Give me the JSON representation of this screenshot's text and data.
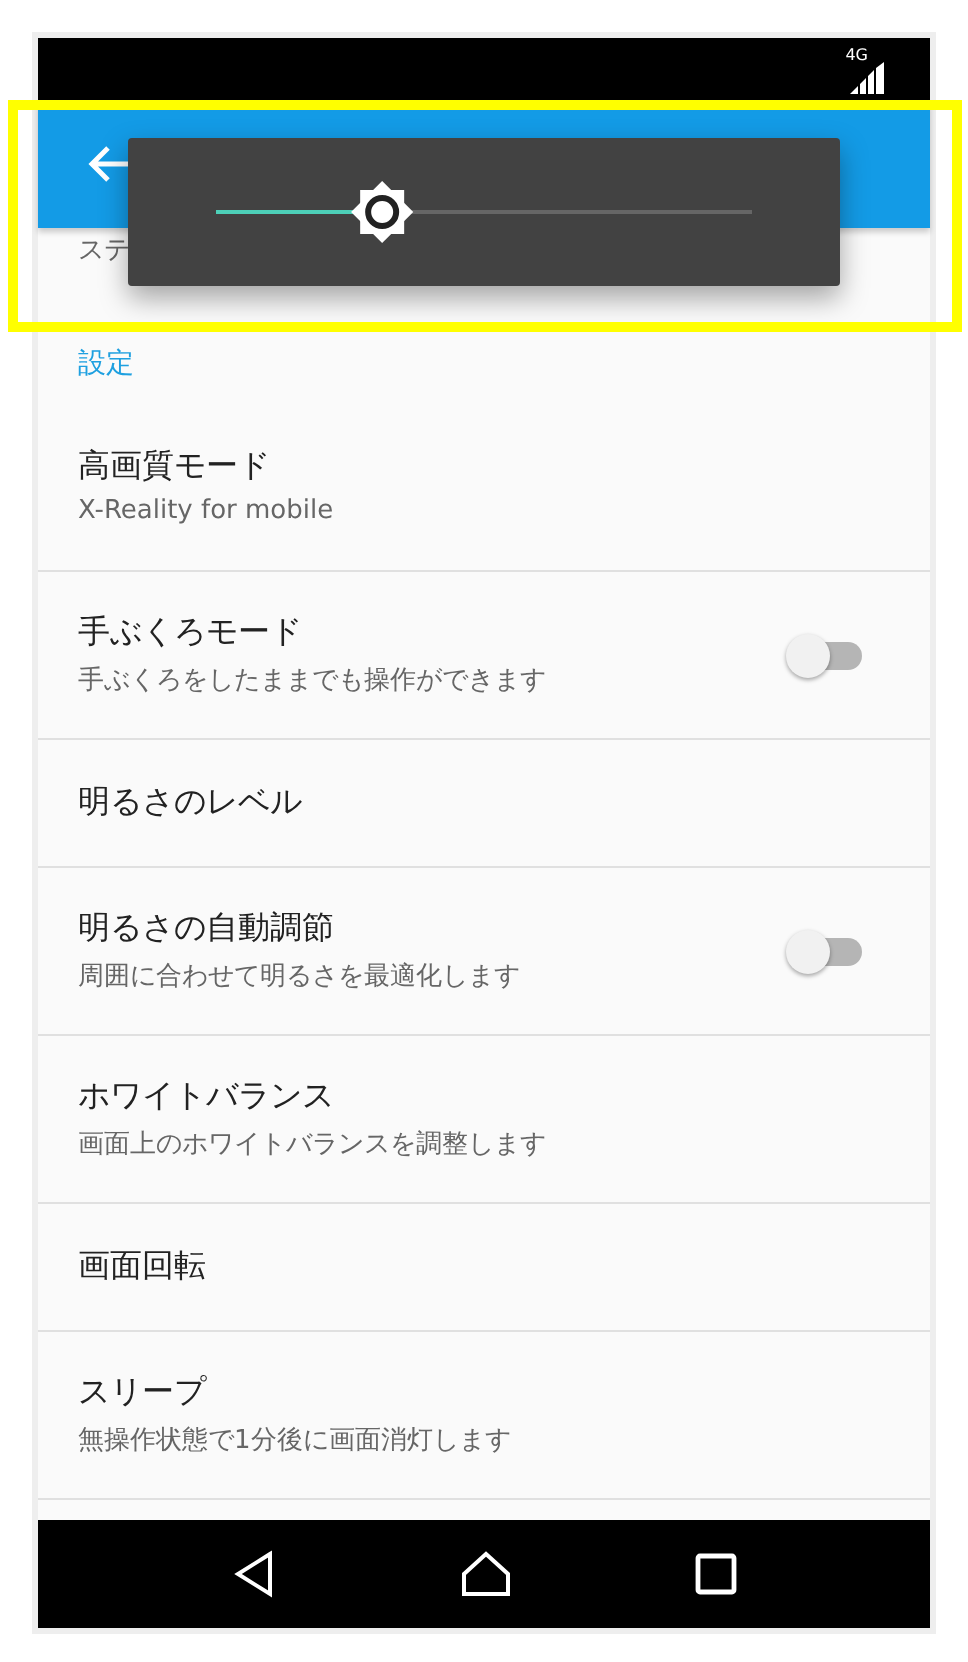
{
  "status_bar": {
    "network": "4G"
  },
  "brightness_popup": {
    "level": 0.31
  },
  "hidden_row": {
    "title": "ステ"
  },
  "section": {
    "title": "設定"
  },
  "settings": [
    {
      "kind": "plain",
      "title": "高画質モード",
      "subtitle": "X-Reality for mobile"
    },
    {
      "kind": "switch",
      "title": "手ぶくろモード",
      "subtitle": "手ぶくろをしたままでも操作ができます",
      "on": false
    },
    {
      "kind": "plain",
      "title": "明るさのレベル"
    },
    {
      "kind": "switch",
      "title": "明るさの自動調節",
      "subtitle": "周囲に合わせて明るさを最適化します",
      "on": false
    },
    {
      "kind": "plain",
      "title": "ホワイトバランス",
      "subtitle": "画面上のホワイトバランスを調整します"
    },
    {
      "kind": "plain",
      "title": "画面回転"
    },
    {
      "kind": "plain",
      "title": "スリープ",
      "subtitle": "無操作状態で1分後に画面消灯します"
    }
  ]
}
